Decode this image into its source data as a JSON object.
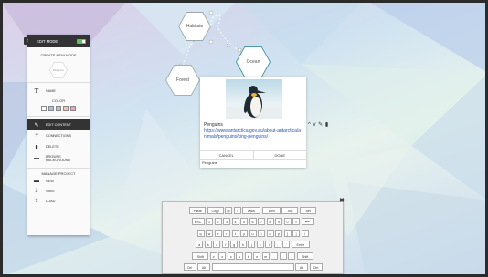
{
  "panel": {
    "edit_mode": "EDIT MODE",
    "create_title": "CREATE NEW NODE",
    "new_node_label": "Drag me",
    "name_label": "NAME",
    "color_label": "COLOR",
    "colors": [
      "#ffffff",
      "#9ec5e8",
      "#a8d5a8",
      "#f2c6a0",
      "#f0a5b5"
    ],
    "edit_content": "EDIT CONTENT",
    "connections": "CONNECTIONS",
    "delete": "DELETE",
    "browse_background": "BROWSE BACKGROUND",
    "manage_title": "MANAGE PROJECT",
    "new": "NEW",
    "save": "SAVE",
    "load": "LOAD"
  },
  "nodes": {
    "habitats": "Habitats",
    "forest": "Forest",
    "ocean": "Ocean"
  },
  "card": {
    "title": "Penguins",
    "link": "https://www.antarctica.gov.au/about-antarctica/animals/penguins/king-penguins/",
    "tools": "^ v ✎ ▮",
    "cancel": "CANCEL",
    "done": "DONE",
    "footer": "Penguins"
  },
  "keyboard": {
    "close": "✖",
    "rows": [
      [
        "Paste",
        "Copy",
        "@",
        "/",
        "www.",
        ".com",
        ".org",
        ".net"
      ],
      [
        "ESC",
        "1",
        "2",
        "3",
        "4",
        "5",
        "6",
        "7",
        "8",
        "9",
        "0",
        "=",
        "⟵"
      ],
      [
        "q",
        "w",
        "e",
        "r",
        "t",
        "y",
        "u",
        "i",
        "o",
        "p",
        "[",
        "]",
        "\\"
      ],
      [
        "a",
        "s",
        "d",
        "f",
        "g",
        "h",
        "j",
        "k",
        "l",
        ";",
        "'",
        "Enter"
      ],
      [
        "Shift",
        "z",
        "x",
        "c",
        "v",
        "b",
        "n",
        "m",
        ",",
        ".",
        "/",
        "Shift"
      ],
      [
        "Ctrl",
        "Alt",
        " ",
        "Alt",
        "Ctrl"
      ]
    ]
  }
}
